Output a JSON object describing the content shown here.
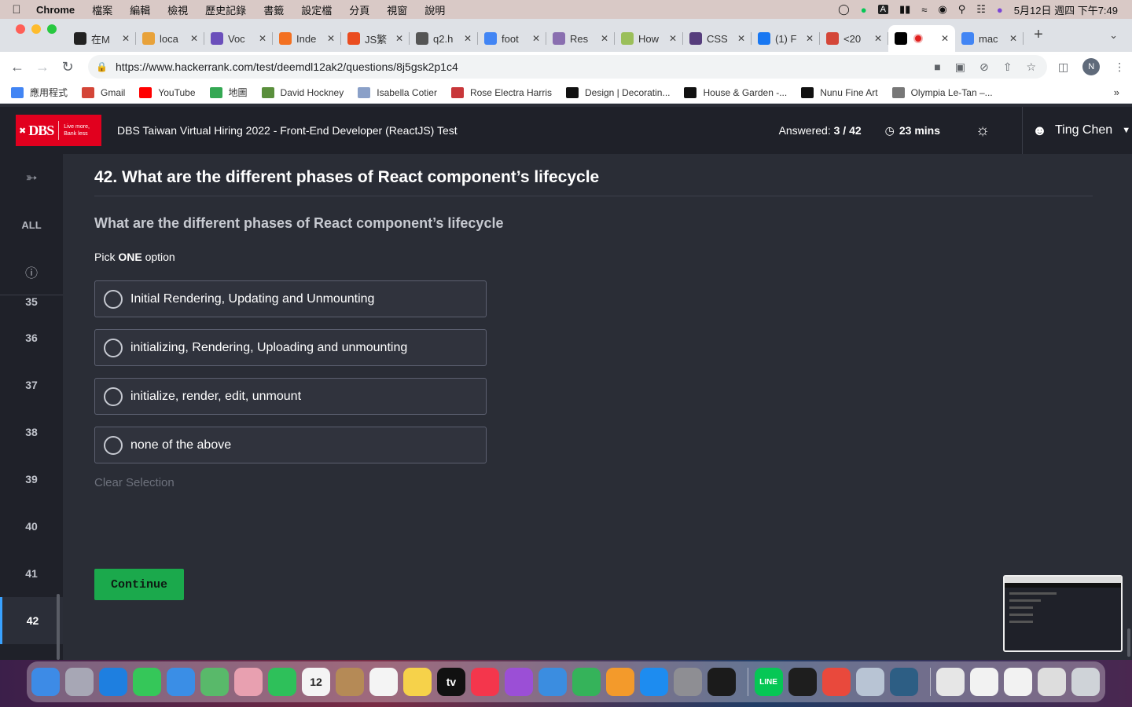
{
  "menubar": {
    "app": "Chrome",
    "items": [
      "檔案",
      "編輯",
      "檢視",
      "歷史記錄",
      "書籤",
      "設定檔",
      "分頁",
      "視窗",
      "說明"
    ],
    "datetime": "5月12日 週四 下午7:49"
  },
  "tabs": [
    {
      "label": "在M",
      "color": "#222222"
    },
    {
      "label": "loca",
      "color": "#e8a23a"
    },
    {
      "label": "Voc",
      "color": "#6b4fbb"
    },
    {
      "label": "Inde",
      "color": "#f37021"
    },
    {
      "label": "JS繁",
      "color": "#ea4c1f"
    },
    {
      "label": "q2.h",
      "color": "#555555"
    },
    {
      "label": "foot",
      "color": "#4285f4"
    },
    {
      "label": "Res",
      "color": "#8a6fb0"
    },
    {
      "label": "How",
      "color": "#9bbf5a"
    },
    {
      "label": "CSS",
      "color": "#563d7c"
    },
    {
      "label": "(1) F",
      "color": "#1877f2"
    },
    {
      "label": "<20",
      "color": "#d44638"
    },
    {
      "label": "",
      "color": "#000000",
      "active": true
    },
    {
      "label": "mac",
      "color": "#4285f4"
    }
  ],
  "omnibox": {
    "url": "https://www.hackerrank.com/test/deemdl12ak2/questions/8j5gsk2p1c4",
    "profile_initial": "N"
  },
  "bookmarks": [
    {
      "label": "應用程式",
      "color": "#4285f4"
    },
    {
      "label": "Gmail",
      "color": "#d44638"
    },
    {
      "label": "YouTube",
      "color": "#ff0000"
    },
    {
      "label": "地圖",
      "color": "#34a853"
    },
    {
      "label": "David Hockney",
      "color": "#5a8f3c"
    },
    {
      "label": "Isabella Cotier",
      "color": "#8aa0c8"
    },
    {
      "label": "Rose Electra Harris",
      "color": "#c8373a"
    },
    {
      "label": "Design | Decoratin...",
      "color": "#111111"
    },
    {
      "label": "House & Garden -...",
      "color": "#111111"
    },
    {
      "label": "Nunu Fine Art",
      "color": "#111111"
    },
    {
      "label": "Olympia Le-Tan –...",
      "color": "#777777"
    }
  ],
  "header": {
    "logo_text": "DBS",
    "logo_tag1": "Live more,",
    "logo_tag2": "Bank less",
    "test_title": "DBS Taiwan Virtual Hiring 2022 - Front-End Developer (ReactJS) Test",
    "answered_label": "Answered:",
    "answered_value": "3 / 42",
    "timer": "23 mins",
    "user_name": "Ting Chen"
  },
  "sidebar": {
    "all_label": "ALL",
    "questions": [
      "35",
      "36",
      "37",
      "38",
      "39",
      "40",
      "41",
      "42"
    ],
    "active": "42"
  },
  "question": {
    "title": "42. What are the different phases of React component’s lifecycle",
    "subtitle": "What are the different phases of React component’s lifecycle",
    "pick_prefix": "Pick",
    "pick_bold": "ONE",
    "pick_suffix": "option",
    "options": [
      "Initial Rendering, Updating and Unmounting",
      "initializing, Rendering, Uploading and unmounting",
      "initialize, render, edit, unmount",
      "none of the above"
    ],
    "clear_label": "Clear Selection",
    "continue_label": "Continue"
  },
  "dock": {
    "apps": [
      {
        "name": "finder",
        "color": "#3d8be6"
      },
      {
        "name": "launchpad",
        "color": "#a7a7b5"
      },
      {
        "name": "safari",
        "color": "#1e7fe0"
      },
      {
        "name": "messages",
        "color": "#35c759"
      },
      {
        "name": "mail",
        "color": "#3a8ee6"
      },
      {
        "name": "maps",
        "color": "#59b96a"
      },
      {
        "name": "photos",
        "color": "#e8a0b0"
      },
      {
        "name": "facetime",
        "color": "#2ec05a"
      },
      {
        "name": "calendar",
        "color": "#f4f4f4",
        "text": "12"
      },
      {
        "name": "contacts",
        "color": "#b58a56"
      },
      {
        "name": "reminders",
        "color": "#f4f4f4"
      },
      {
        "name": "notes",
        "color": "#f6d24a"
      },
      {
        "name": "tv",
        "color": "#111111",
        "text": "tv"
      },
      {
        "name": "music",
        "color": "#f4364c"
      },
      {
        "name": "podcasts",
        "color": "#9b4fd6"
      },
      {
        "name": "keynote",
        "color": "#3b8de0"
      },
      {
        "name": "numbers",
        "color": "#35b35a"
      },
      {
        "name": "pages",
        "color": "#f39a2b"
      },
      {
        "name": "app-store",
        "color": "#1d8cf0"
      },
      {
        "name": "system-preferences",
        "color": "#8e8e93"
      },
      {
        "name": "terminal",
        "color": "#1b1b1b"
      },
      {
        "name": "line",
        "color": "#06c755",
        "text": "LINE"
      },
      {
        "name": "activity-monitor",
        "color": "#1e1e1e"
      },
      {
        "name": "chrome",
        "color": "#e9493c"
      },
      {
        "name": "utility",
        "color": "#b8c4d4"
      },
      {
        "name": "mysql-workbench",
        "color": "#2d5e84"
      },
      {
        "name": "archive",
        "color": "#e6e6e6"
      },
      {
        "name": "document",
        "color": "#f2f2f2"
      },
      {
        "name": "document-2",
        "color": "#f2f2f2"
      },
      {
        "name": "screenshot",
        "color": "#dddddd"
      },
      {
        "name": "trash",
        "color": "#cfd3d8"
      }
    ]
  }
}
